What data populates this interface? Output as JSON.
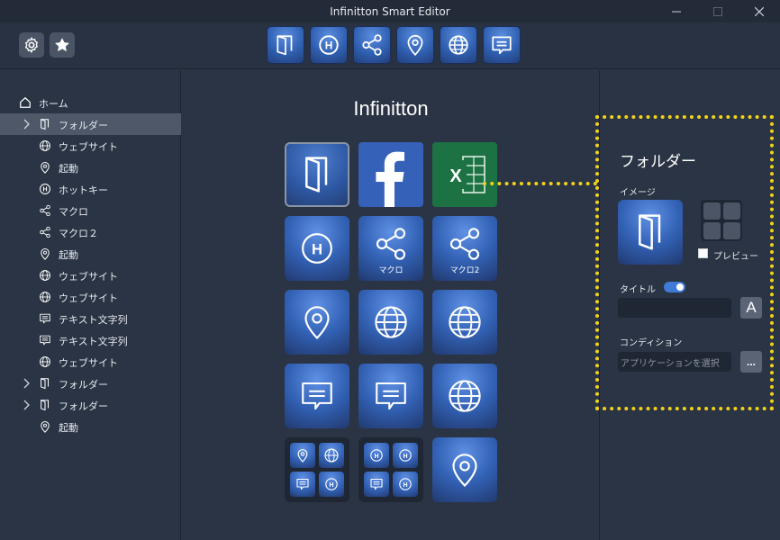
{
  "window": {
    "title": "Infinitton Smart Editor"
  },
  "toolbar": {
    "settings_icon": "gear-icon",
    "favorite_icon": "star-icon",
    "action_icons": [
      "folder-icon",
      "hotkey-icon",
      "macro-icon",
      "launch-icon",
      "website-icon",
      "text-icon"
    ]
  },
  "sidebar": {
    "home": "ホーム",
    "items": [
      {
        "label": "フォルダー",
        "icon": "folder-icon",
        "expandable": true,
        "selected": true
      },
      {
        "label": "ウェブサイト",
        "icon": "globe-icon"
      },
      {
        "label": "起動",
        "icon": "pin-icon"
      },
      {
        "label": "ホットキー",
        "icon": "hotkey-icon"
      },
      {
        "label": "マクロ",
        "icon": "share-icon"
      },
      {
        "label": "マクロ２",
        "icon": "share-icon"
      },
      {
        "label": "起動",
        "icon": "pin-icon"
      },
      {
        "label": "ウェブサイト",
        "icon": "globe-icon"
      },
      {
        "label": "ウェブサイト",
        "icon": "globe-icon"
      },
      {
        "label": "テキスト文字列",
        "icon": "message-icon"
      },
      {
        "label": "テキスト文字列",
        "icon": "message-icon"
      },
      {
        "label": "ウェブサイト",
        "icon": "globe-icon"
      },
      {
        "label": "フォルダー",
        "icon": "folder-icon",
        "expandable": true
      },
      {
        "label": "フォルダー",
        "icon": "folder-icon",
        "expandable": true
      },
      {
        "label": "起動",
        "icon": "pin-icon"
      }
    ]
  },
  "center": {
    "heading": "Infinitton",
    "tiles": [
      {
        "icon": "folder-icon",
        "selected": true
      },
      {
        "icon": "facebook-logo"
      },
      {
        "icon": "excel-logo"
      },
      {
        "icon": "hotkey-icon"
      },
      {
        "icon": "share-icon",
        "caption": "マクロ"
      },
      {
        "icon": "share-icon",
        "caption": "マクロ2"
      },
      {
        "icon": "pin-icon"
      },
      {
        "icon": "globe-icon"
      },
      {
        "icon": "globe-icon"
      },
      {
        "icon": "message-icon"
      },
      {
        "icon": "message-icon"
      },
      {
        "icon": "globe-icon"
      },
      {
        "icon": "multi-folder"
      },
      {
        "icon": "multi-folder"
      },
      {
        "icon": "pin-icon"
      }
    ]
  },
  "properties": {
    "title": "フォルダー",
    "image_label": "イメージ",
    "preview_label": "プレビュー",
    "title_label": "タイトル",
    "title_value": "",
    "font_button": "A",
    "condition_label": "コンディション",
    "condition_placeholder": "アプリケーションを選択",
    "browse_button": "...",
    "accent_color": "#f2d21a"
  }
}
